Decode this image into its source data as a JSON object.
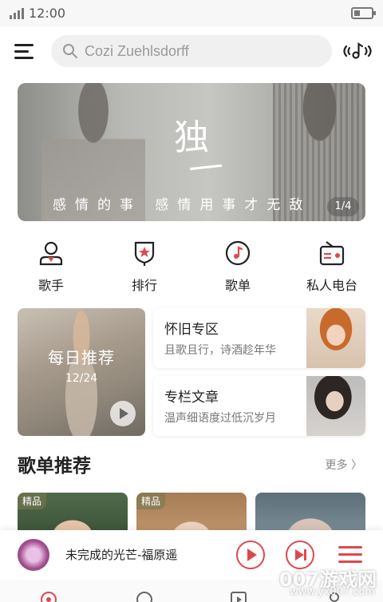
{
  "status_bar": {
    "time": "12:00"
  },
  "search": {
    "placeholder": "Cozi Zuehlsdorff"
  },
  "banner": {
    "title": "独",
    "text": "感情的事 感情用事才无敌",
    "page": "1/4"
  },
  "nav": [
    {
      "label": "歌手",
      "icon": "singer-icon"
    },
    {
      "label": "排行",
      "icon": "ranking-icon"
    },
    {
      "label": "歌单",
      "icon": "playlist-icon"
    },
    {
      "label": "私人电台",
      "icon": "radio-icon"
    }
  ],
  "daily": {
    "title": "每日推荐",
    "date": "12/24"
  },
  "cards": [
    {
      "title": "怀旧专区",
      "subtitle": "且歌且行，诗酒趁年华"
    },
    {
      "title": "专栏文章",
      "subtitle": "温声细语度过低沉岁月"
    }
  ],
  "section": {
    "title": "歌单推荐",
    "more": "更多 〉"
  },
  "playlists": [
    {
      "badge": "精品"
    },
    {
      "badge": "精品"
    },
    {
      "badge": ""
    }
  ],
  "player": {
    "title": "未完成的光芒-福原遥"
  },
  "watermark": {
    "text": "007游戏网",
    "url": "www.yx007.com"
  },
  "colors": {
    "accent": "#e0474c",
    "background": "#ffffff"
  }
}
